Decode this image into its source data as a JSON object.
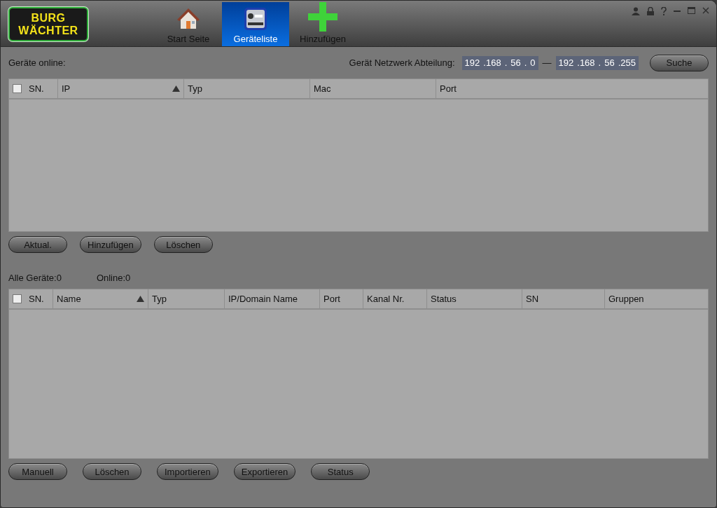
{
  "logo": {
    "line_1": "BURG",
    "line_2": "WÄCHTER"
  },
  "tabs": [
    {
      "label": "Start Seite",
      "kind": "home",
      "selected": false
    },
    {
      "label": "Geräteliste",
      "kind": "devices",
      "selected": true
    },
    {
      "label": "Hinzufügen",
      "kind": "add",
      "selected": false
    }
  ],
  "online_section": {
    "title": "Geräte online:",
    "range_label": "Gerät Netzwerk Abteilung:",
    "range_from": [
      "192",
      ".168",
      ".",
      "56",
      ".",
      "0"
    ],
    "range_dash": "—",
    "range_to": [
      "192",
      ".168",
      ".",
      "56",
      ".255"
    ],
    "search_button": "Suche",
    "table": {
      "select_all_checked": false,
      "columns": [
        {
          "label": "SN.",
          "sorted": false
        },
        {
          "label": "IP",
          "sorted": true
        },
        {
          "label": "Typ",
          "sorted": false
        },
        {
          "label": "Mac",
          "sorted": false
        },
        {
          "label": "Port",
          "sorted": false
        }
      ]
    },
    "buttons": [
      "Aktual.",
      "Hinzufügen",
      "Löschen"
    ]
  },
  "all_section": {
    "all_count": "Alle Geräte:0",
    "online_count": "Online:0",
    "table": {
      "select_all_checked": false,
      "columns": [
        {
          "label": "SN.",
          "sorted": false
        },
        {
          "label": "Name",
          "sorted": true
        },
        {
          "label": "Typ",
          "sorted": false
        },
        {
          "label": "IP/Domain Name",
          "sorted": false
        },
        {
          "label": "Port",
          "sorted": false
        },
        {
          "label": "Kanal Nr.",
          "sorted": false
        },
        {
          "label": "Status",
          "sorted": false
        },
        {
          "label": "SN",
          "sorted": false
        },
        {
          "label": "Gruppen",
          "sorted": false
        }
      ]
    },
    "buttons": [
      "Manuell",
      "Löschen",
      "Importieren",
      "Exportieren",
      "Status"
    ]
  }
}
